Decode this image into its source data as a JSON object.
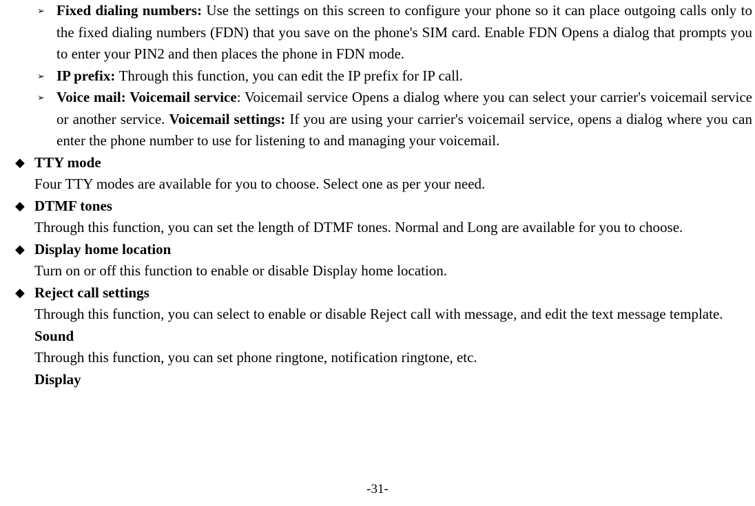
{
  "arrows": {
    "fdn": {
      "label": "Fixed dialing numbers: ",
      "text": "Use the settings on this screen to configure your phone so it can place outgoing calls only to the fixed dialing numbers (FDN) that you save on the phone's SIM card. Enable FDN Opens a dialog that prompts you to enter your PIN2 and then places the phone in FDN mode."
    },
    "ip": {
      "label": "IP prefix: ",
      "text": "Through this function, you can edit the IP prefix for IP call."
    },
    "vm": {
      "label1": "Voice mail: Voicemail service",
      "text1": ": Voicemail service Opens a dialog where you can select your carrier's voicemail service or another service. ",
      "label2": "Voicemail settings: ",
      "text2": "If you are using your carrier's voicemail service, opens a dialog where you can enter the phone number to use for listening to and managing your voicemail."
    }
  },
  "diamonds": {
    "tty": {
      "label": "TTY mode",
      "text": "Four TTY modes are available for you to choose. Select one as per your need."
    },
    "dtmf": {
      "label": "DTMF tones",
      "text": "Through this function, you can set the length of DTMF tones. Normal and Long are available for you to choose."
    },
    "dhl": {
      "label": "Display home location",
      "text": "Turn on or off this function to enable or disable Display home location."
    },
    "reject": {
      "label": "Reject call settings",
      "text": "Through this function, you can select to enable or disable Reject call with message, and edit the text message template."
    }
  },
  "extra": {
    "sound": {
      "label": "Sound",
      "text": "Through this function, you can set phone ringtone, notification ringtone, etc."
    },
    "display": {
      "label": "Display"
    }
  },
  "bullets": {
    "arrow": "➢",
    "diamond": "◆"
  },
  "page": "-31-"
}
